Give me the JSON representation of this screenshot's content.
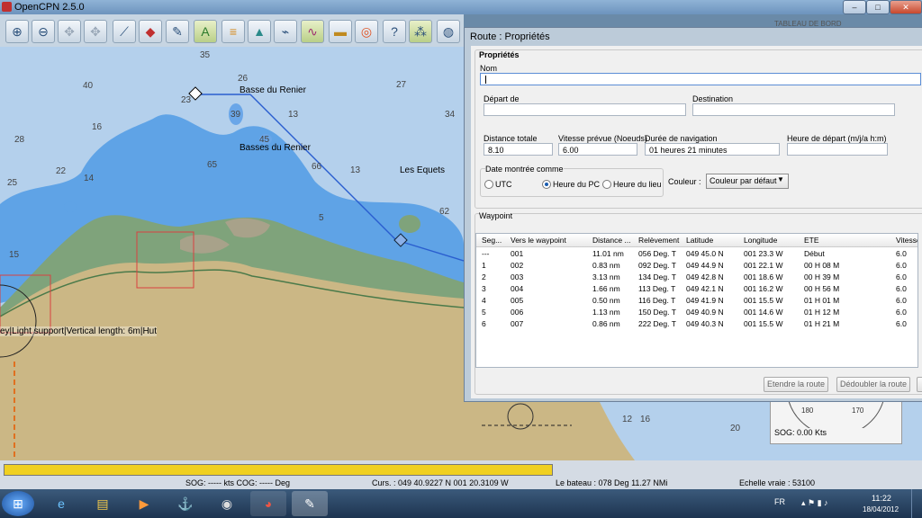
{
  "window": {
    "title": "OpenCPN 2.5.0",
    "btn_min": "–",
    "btn_max": "□",
    "btn_close": "✕"
  },
  "toolbar": {
    "icons": [
      "zoom-in-icon",
      "zoom-out-icon",
      "scale-in-icon",
      "scale-out-icon",
      "route-icon",
      "boat-icon",
      "tools-icon",
      "text-icon",
      "layers-icon",
      "chart-icon",
      "graph-icon",
      "tide-icon",
      "color-icon",
      "lifebuoy-icon",
      "help-icon",
      "ais-icon",
      "globe-icon"
    ]
  },
  "chart": {
    "soundings": [
      "35",
      "40",
      "26",
      "27",
      "34",
      "23",
      "39",
      "13",
      "16",
      "28",
      "45",
      "22",
      "14",
      "25",
      "65",
      "13",
      "66",
      "5",
      "62",
      "15",
      "12",
      "16",
      "20",
      "22",
      "24"
    ],
    "labels": {
      "basse_renier": "Basse du Renier",
      "basses_renier": "Basses du Renier",
      "les_equets": "Les Equets"
    },
    "object_info": "ey|Light support|Vertical length: 6m|Hut",
    "panel_title": "TABLEAU DE BORD",
    "sog_text": "SOG: 0.00 Kts",
    "compass": [
      "180",
      "170"
    ]
  },
  "dialog": {
    "title": "Route : Propriétés",
    "props_group": "Propriétés",
    "name_label": "Nom",
    "name_value": "",
    "depart_label": "Départ de",
    "depart_value": "",
    "dest_label": "Destination",
    "dest_value": "",
    "dist_label": "Distance totale",
    "dist_value": "8.10",
    "speed_label": "Vitesse prévue (Noeuds)",
    "speed_value": "6.00",
    "duration_label": "Durée de navigation",
    "duration_value": "01 heures  21 minutes",
    "start_label": "Heure de départ (m/j/a h:m)",
    "start_value": "",
    "datetime_group": "Date montrée comme",
    "radio_utc": "UTC",
    "radio_pc": "Heure du PC",
    "radio_local": "Heure du lieu",
    "color_label": "Couleur :",
    "color_value": "Couleur par défaut",
    "waypoint_group": "Waypoint",
    "columns": [
      "Seg...",
      "Vers le waypoint",
      "Distance ...",
      "Relèvement",
      "Latitude",
      "Longitude",
      "ETE",
      "Vitesse"
    ],
    "rows": [
      [
        "---",
        "001",
        "11.01 nm",
        "056 Deg. T",
        "049 45.0 N",
        "001 23.3 W",
        "Début",
        "6.0"
      ],
      [
        "1",
        "002",
        "0.83 nm",
        "092 Deg. T",
        "049 44.9 N",
        "001 22.1 W",
        "00 H  08 M",
        "6.0"
      ],
      [
        "2",
        "003",
        "3.13 nm",
        "134 Deg. T",
        "049 42.8 N",
        "001 18.6 W",
        "00 H  39 M",
        "6.0"
      ],
      [
        "3",
        "004",
        "1.66 nm",
        "113 Deg. T",
        "049 42.1 N",
        "001 16.2 W",
        "00 H  56 M",
        "6.0"
      ],
      [
        "4",
        "005",
        "0.50 nm",
        "116 Deg. T",
        "049 41.9 N",
        "001 15.5 W",
        "01 H  01 M",
        "6.0"
      ],
      [
        "5",
        "006",
        "1.13 nm",
        "150 Deg. T",
        "049 40.9 N",
        "001 14.6 W",
        "01 H  12 M",
        "6.0"
      ],
      [
        "6",
        "007",
        "0.86 nm",
        "222 Deg. T",
        "049 40.3 N",
        "001 15.5 W",
        "01 H  21 M",
        "6.0"
      ]
    ],
    "btn_extend": "Etendre la route",
    "btn_split": "Dédoubler la route"
  },
  "status": {
    "sog_cog": "SOG: ----- kts  COG: ----- Deg",
    "cursor": "Curs. : 049 40.9227 N 001 20.3109 W",
    "boat": "Le bateau : 078 Deg     11.27 NMi",
    "scale": "Echelle vraie :     53100",
    "progress": 1.0
  },
  "taskbar": {
    "lang": "FR",
    "time": "11:22",
    "date": "18/04/2012",
    "apps": [
      "start-orb-icon",
      "ie-icon",
      "explorer-icon",
      "media-icon",
      "opencpn-icon",
      "chrome-icon",
      "doc-icon"
    ]
  }
}
